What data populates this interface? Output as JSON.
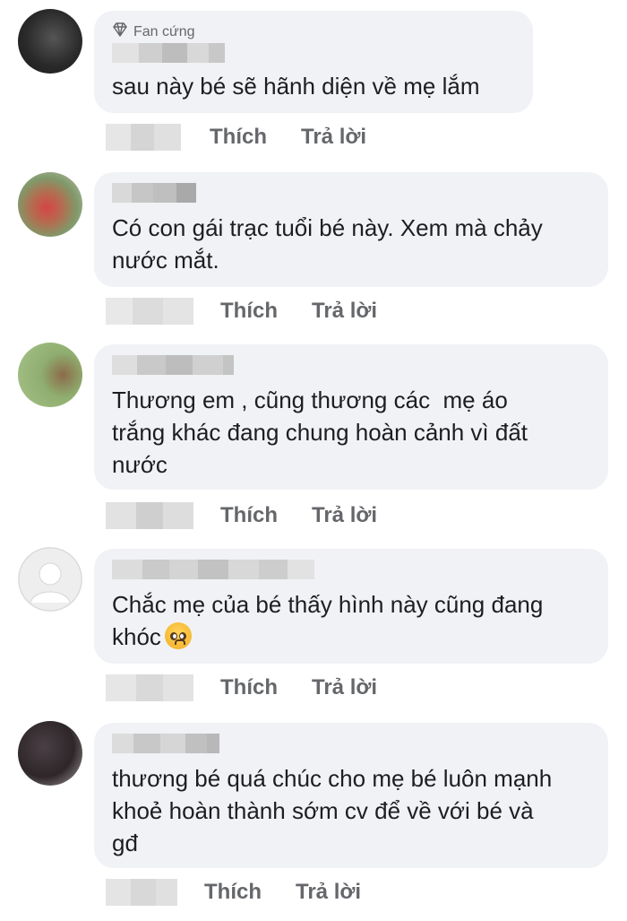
{
  "actions": {
    "like_label": "Thích",
    "reply_label": "Trả lời"
  },
  "comments": [
    {
      "badge": "Fan cứng",
      "text": "sau này bé sẽ hãnh diện về mẹ lắm"
    },
    {
      "text": "Có con gái trạc tuổi bé này. Xem mà chảy\nnước mắt."
    },
    {
      "text": "Thương em , cũng thương các  mẹ áo\ntrắng khác đang chung hoàn cảnh vì đất\nnước"
    },
    {
      "text": "Chắc mẹ của bé thấy hình này cũng đang\nkhóc",
      "emoji": "crying-face-emoji"
    },
    {
      "text": "thương bé quá chúc cho mẹ bé luôn mạnh\nkhoẻ hoàn thành sớm cv để về với bé và\ngđ"
    }
  ],
  "colors": {
    "bubble": "#f0f2f5",
    "text": "#1c1e21",
    "muted": "#65676b"
  }
}
